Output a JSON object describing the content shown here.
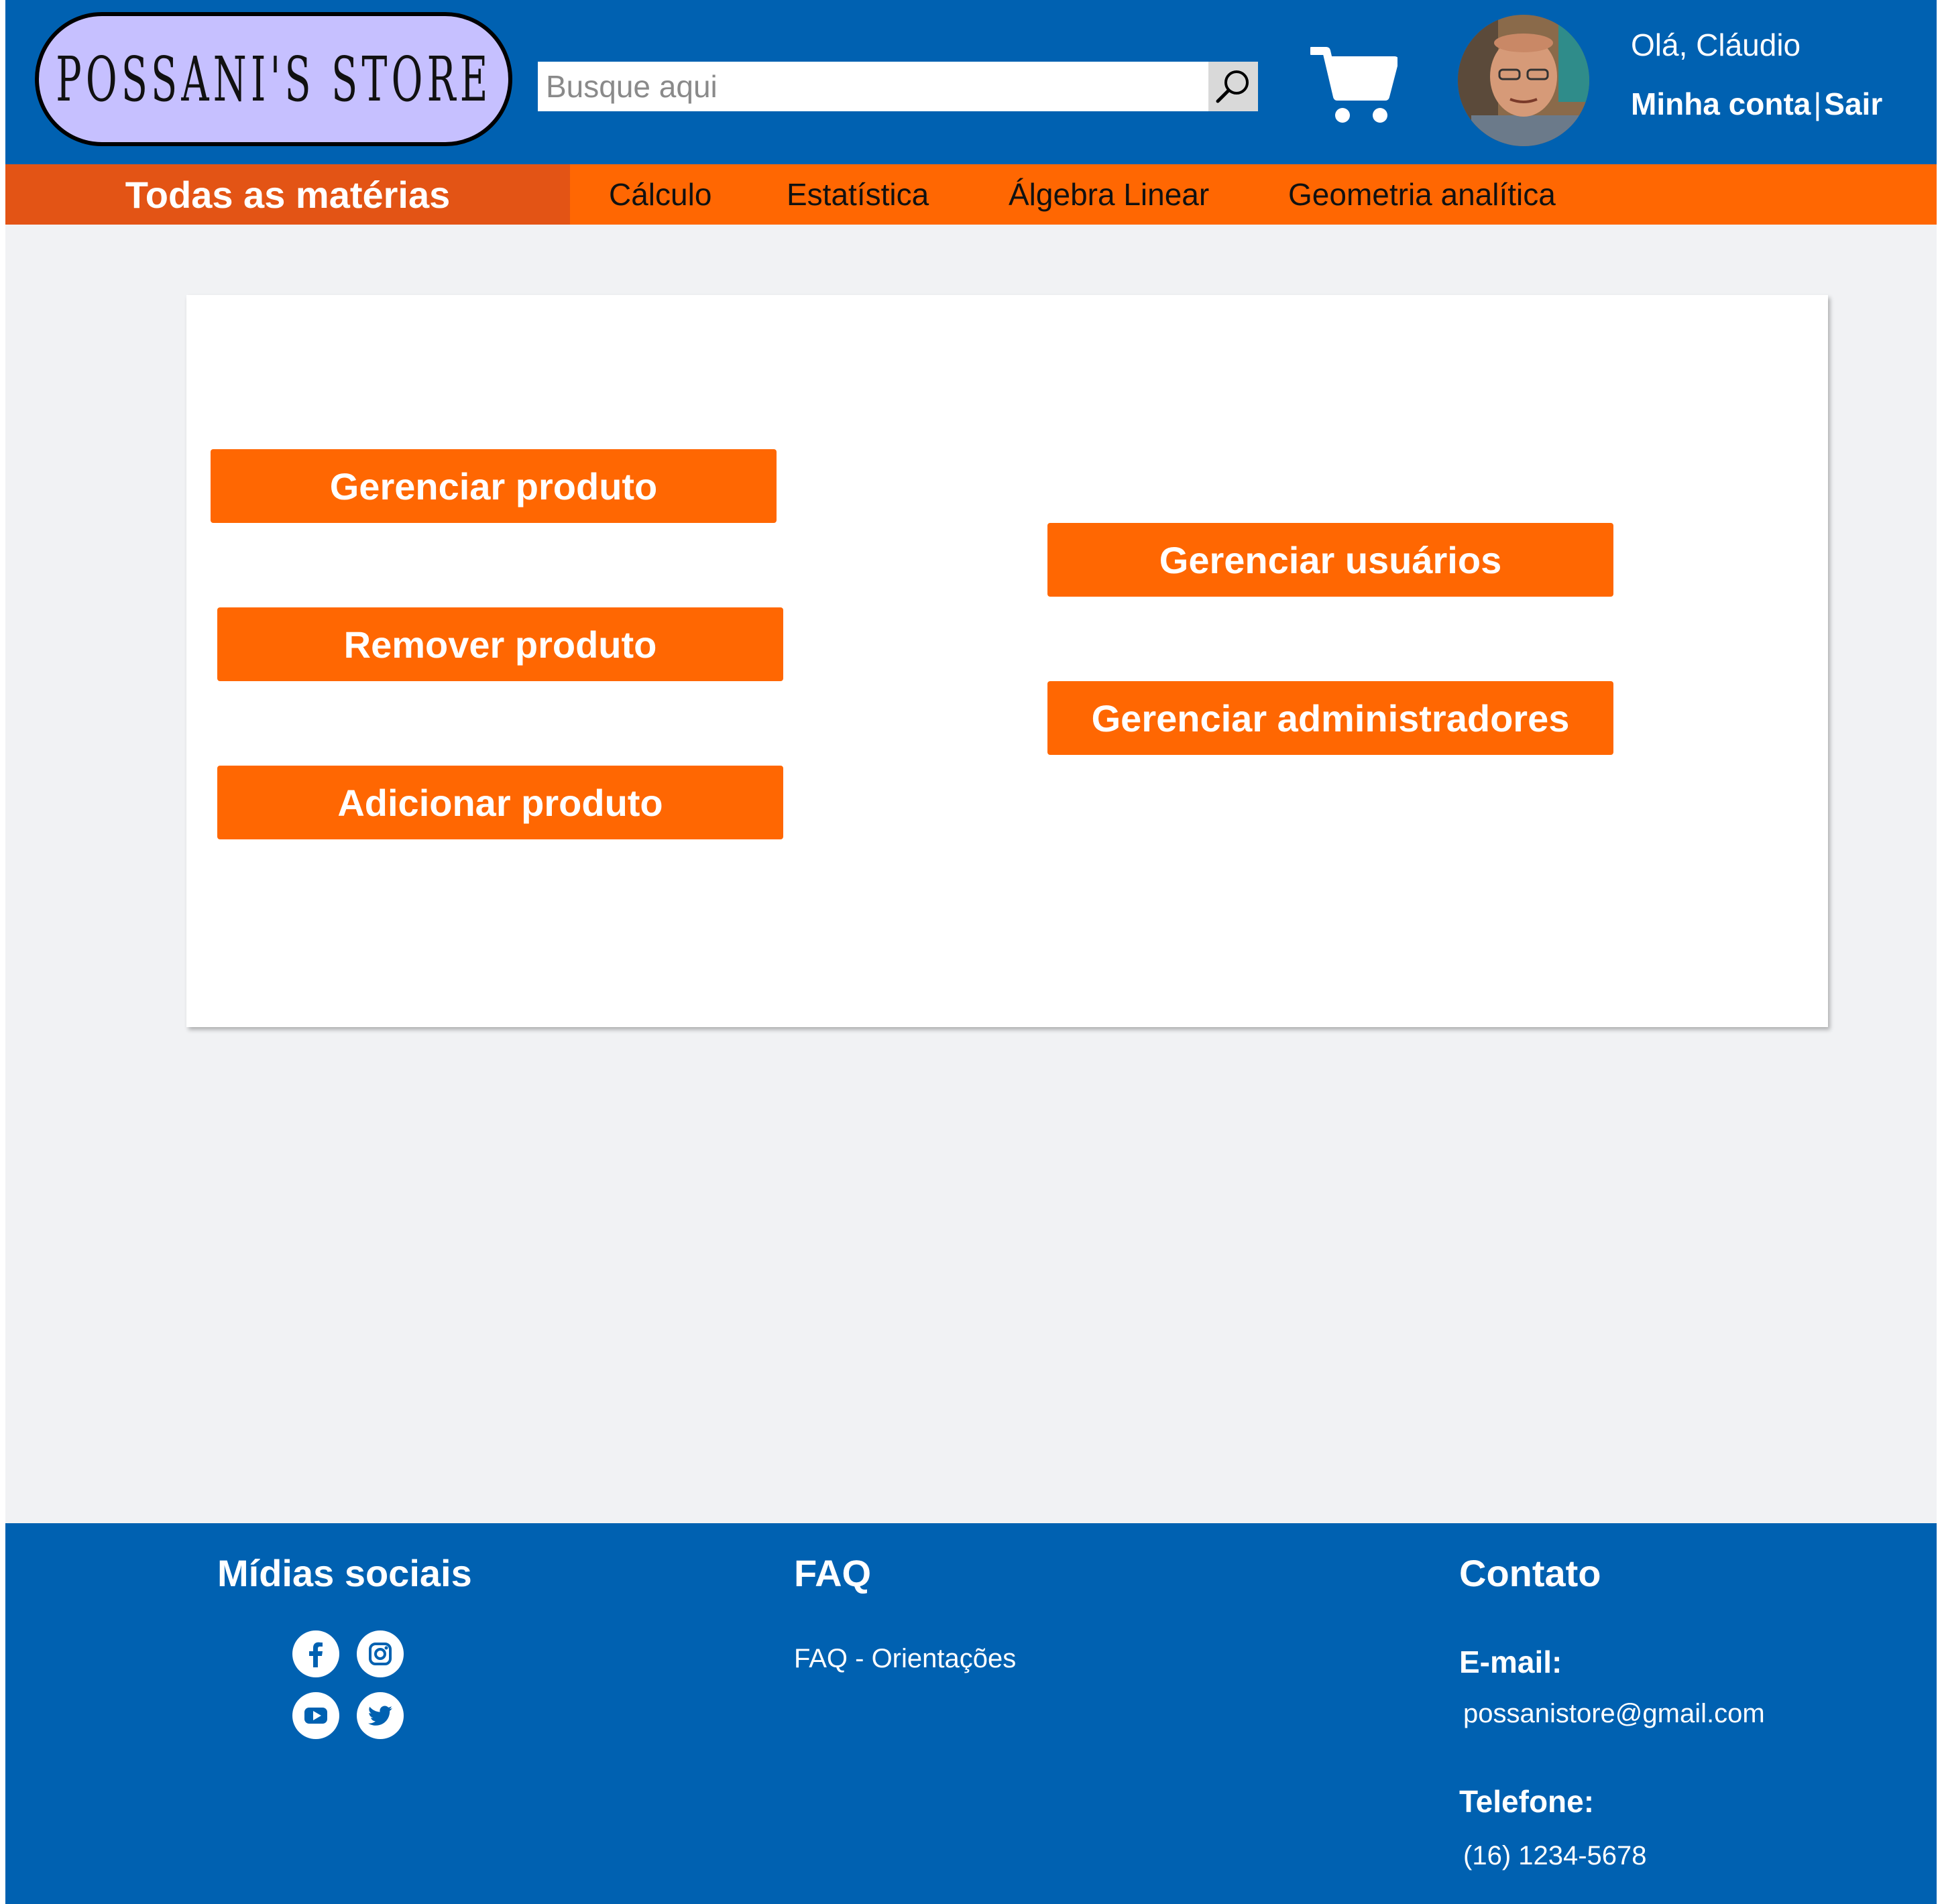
{
  "header": {
    "logo_text": "POSSANI'S STORE",
    "search_placeholder": "Busque aqui",
    "greeting": "Olá, Cláudio",
    "my_account": "Minha conta",
    "separator": "|",
    "logout": "Sair"
  },
  "nav": {
    "all_subjects": "Todas as matérias",
    "items": [
      "Cálculo",
      "Estatística",
      "Álgebra Linear",
      "Geometria analítica"
    ]
  },
  "admin": {
    "manage_product": "Gerenciar produto",
    "remove_product": "Remover produto",
    "add_product": "Adicionar produto",
    "manage_users": "Gerenciar usuários",
    "manage_admins": "Gerenciar administradores"
  },
  "footer": {
    "social_title": "Mídias sociais",
    "social_icons": [
      "facebook-icon",
      "instagram-icon",
      "youtube-icon",
      "twitter-icon"
    ],
    "faq_title": "FAQ",
    "faq_link": "FAQ - Orientações",
    "contact_title": "Contato",
    "email_label": "E-mail:",
    "email_value": "possanistore@gmail.com",
    "phone_label": "Telefone:",
    "phone_value": "(16) 1234-5678"
  },
  "colors": {
    "header_blue": "#0061b1",
    "orange": "#ff6702",
    "orange_dark": "#e35415",
    "logo_bg": "#c6c0ff",
    "page_bg": "#f1f2f4"
  }
}
